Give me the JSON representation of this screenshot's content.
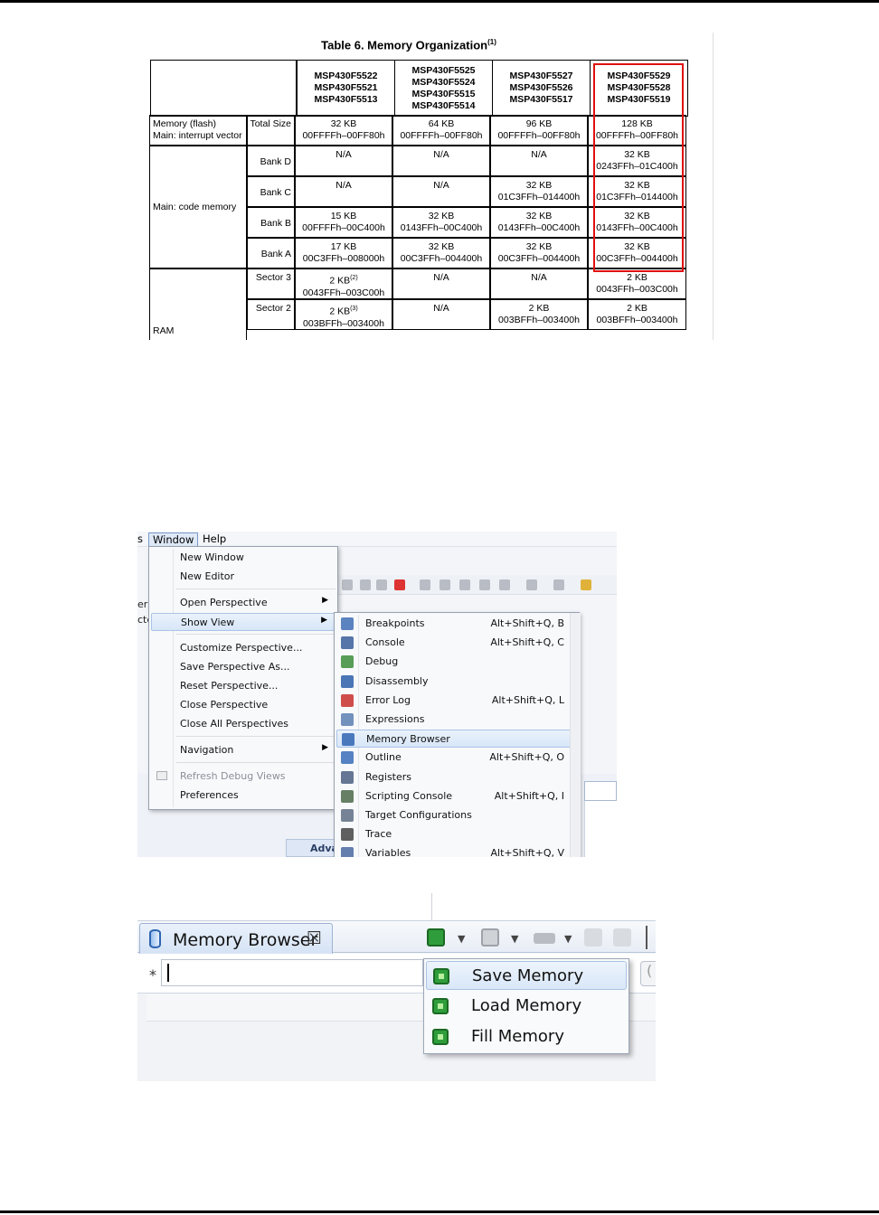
{
  "table": {
    "title": "Table 6. Memory Organization",
    "title_sup": "(1)",
    "headers": [
      [
        "MSP430F5522",
        "MSP430F5521",
        "MSP430F5513"
      ],
      [
        "MSP430F5525",
        "MSP430F5524",
        "MSP430F5515",
        "MSP430F5514"
      ],
      [
        "MSP430F5527",
        "MSP430F5526",
        "MSP430F5517"
      ],
      [
        "MSP430F5529",
        "MSP430F5528",
        "MSP430F5519"
      ]
    ],
    "flash_label": [
      "Memory (flash)",
      "Main: interrupt vector"
    ],
    "total_size_label": "Total Size",
    "total_size": [
      [
        "32 KB",
        "00FFFFh–00FF80h"
      ],
      [
        "64 KB",
        "00FFFFh–00FF80h"
      ],
      [
        "96 KB",
        "00FFFFh–00FF80h"
      ],
      [
        "128 KB",
        "00FFFFh–00FF80h"
      ]
    ],
    "code_label": "Main: code memory",
    "bank_d_label": "Bank D",
    "bank_d": [
      [
        "N/A"
      ],
      [
        "N/A"
      ],
      [
        "N/A"
      ],
      [
        "32 KB",
        "0243FFh–01C400h"
      ]
    ],
    "bank_c_label": "Bank C",
    "bank_c": [
      [
        "N/A"
      ],
      [
        "N/A"
      ],
      [
        "32 KB",
        "01C3FFh–014400h"
      ],
      [
        "32 KB",
        "01C3FFh–014400h"
      ]
    ],
    "bank_b_label": "Bank B",
    "bank_b": [
      [
        "15 KB",
        "00FFFFh–00C400h"
      ],
      [
        "32 KB",
        "0143FFh–00C400h"
      ],
      [
        "32 KB",
        "0143FFh–00C400h"
      ],
      [
        "32 KB",
        "0143FFh–00C400h"
      ]
    ],
    "bank_a_label": "Bank A",
    "bank_a": [
      [
        "17 KB",
        "00C3FFh–008000h"
      ],
      [
        "32 KB",
        "00C3FFh–004400h"
      ],
      [
        "32 KB",
        "00C3FFh–004400h"
      ],
      [
        "32 KB",
        "00C3FFh–004400h"
      ]
    ],
    "ram_label": "RAM",
    "sector3_label": "Sector 3",
    "sector3": [
      [
        "2 KB",
        "0043FFh–003C00h"
      ],
      [
        "N/A"
      ],
      [
        "N/A"
      ],
      [
        "2 KB",
        "0043FFh–003C00h"
      ]
    ],
    "sector3_sup": "(2)",
    "sector2_label": "Sector 2",
    "sector2": [
      [
        "2 KB",
        "003BFFh–003400h"
      ],
      [
        "N/A"
      ],
      [
        "2 KB",
        "003BFFh–003400h"
      ],
      [
        "2 KB",
        "003BFFh–003400h"
      ]
    ],
    "sector2_sup": "(3)",
    "highlight_color": "#e01010"
  },
  "menu": {
    "menubar": {
      "partial": "s",
      "window": "Window",
      "help": "Help"
    },
    "bg_left": [
      "er",
      "cte"
    ],
    "bg_tab": "Adva",
    "window_items": {
      "new_window": "New Window",
      "new_editor": "New Editor",
      "open_perspective": "Open Perspective",
      "show_view": "Show View",
      "customize_perspective": "Customize Perspective...",
      "save_perspective_as": "Save Perspective As...",
      "reset_perspective": "Reset Perspective...",
      "close_perspective": "Close Perspective",
      "close_all_perspectives": "Close All Perspectives",
      "navigation": "Navigation",
      "refresh_debug_views": "Refresh Debug Views",
      "preferences": "Preferences"
    },
    "show_view_items": [
      {
        "label": "Breakpoints",
        "shortcut": "Alt+Shift+Q, B",
        "icon": "breakpoints-icon"
      },
      {
        "label": "Console",
        "shortcut": "Alt+Shift+Q, C",
        "icon": "console-icon"
      },
      {
        "label": "Debug",
        "shortcut": "",
        "icon": "debug-icon"
      },
      {
        "label": "Disassembly",
        "shortcut": "",
        "icon": "disassembly-icon"
      },
      {
        "label": "Error Log",
        "shortcut": "Alt+Shift+Q, L",
        "icon": "error-log-icon"
      },
      {
        "label": "Expressions",
        "shortcut": "",
        "icon": "expressions-icon"
      },
      {
        "label": "Memory Browser",
        "shortcut": "",
        "icon": "memory-browser-icon"
      },
      {
        "label": "Outline",
        "shortcut": "Alt+Shift+Q, O",
        "icon": "outline-icon"
      },
      {
        "label": "Registers",
        "shortcut": "",
        "icon": "registers-icon"
      },
      {
        "label": "Scripting Console",
        "shortcut": "Alt+Shift+Q, I",
        "icon": "scripting-console-icon"
      },
      {
        "label": "Target Configurations",
        "shortcut": "",
        "icon": "target-configurations-icon"
      },
      {
        "label": "Trace",
        "shortcut": "",
        "icon": "trace-icon"
      },
      {
        "label": "Variables",
        "shortcut": "Alt+Shift+Q, V",
        "icon": "variables-icon"
      }
    ]
  },
  "memory_browser": {
    "tab_label": "Memory Browser",
    "close_glyph": "☒",
    "input_prefix": "*",
    "right_btn_glyph": "(",
    "dropdown": [
      "Save Memory",
      "Load Memory",
      "Fill Memory"
    ]
  }
}
